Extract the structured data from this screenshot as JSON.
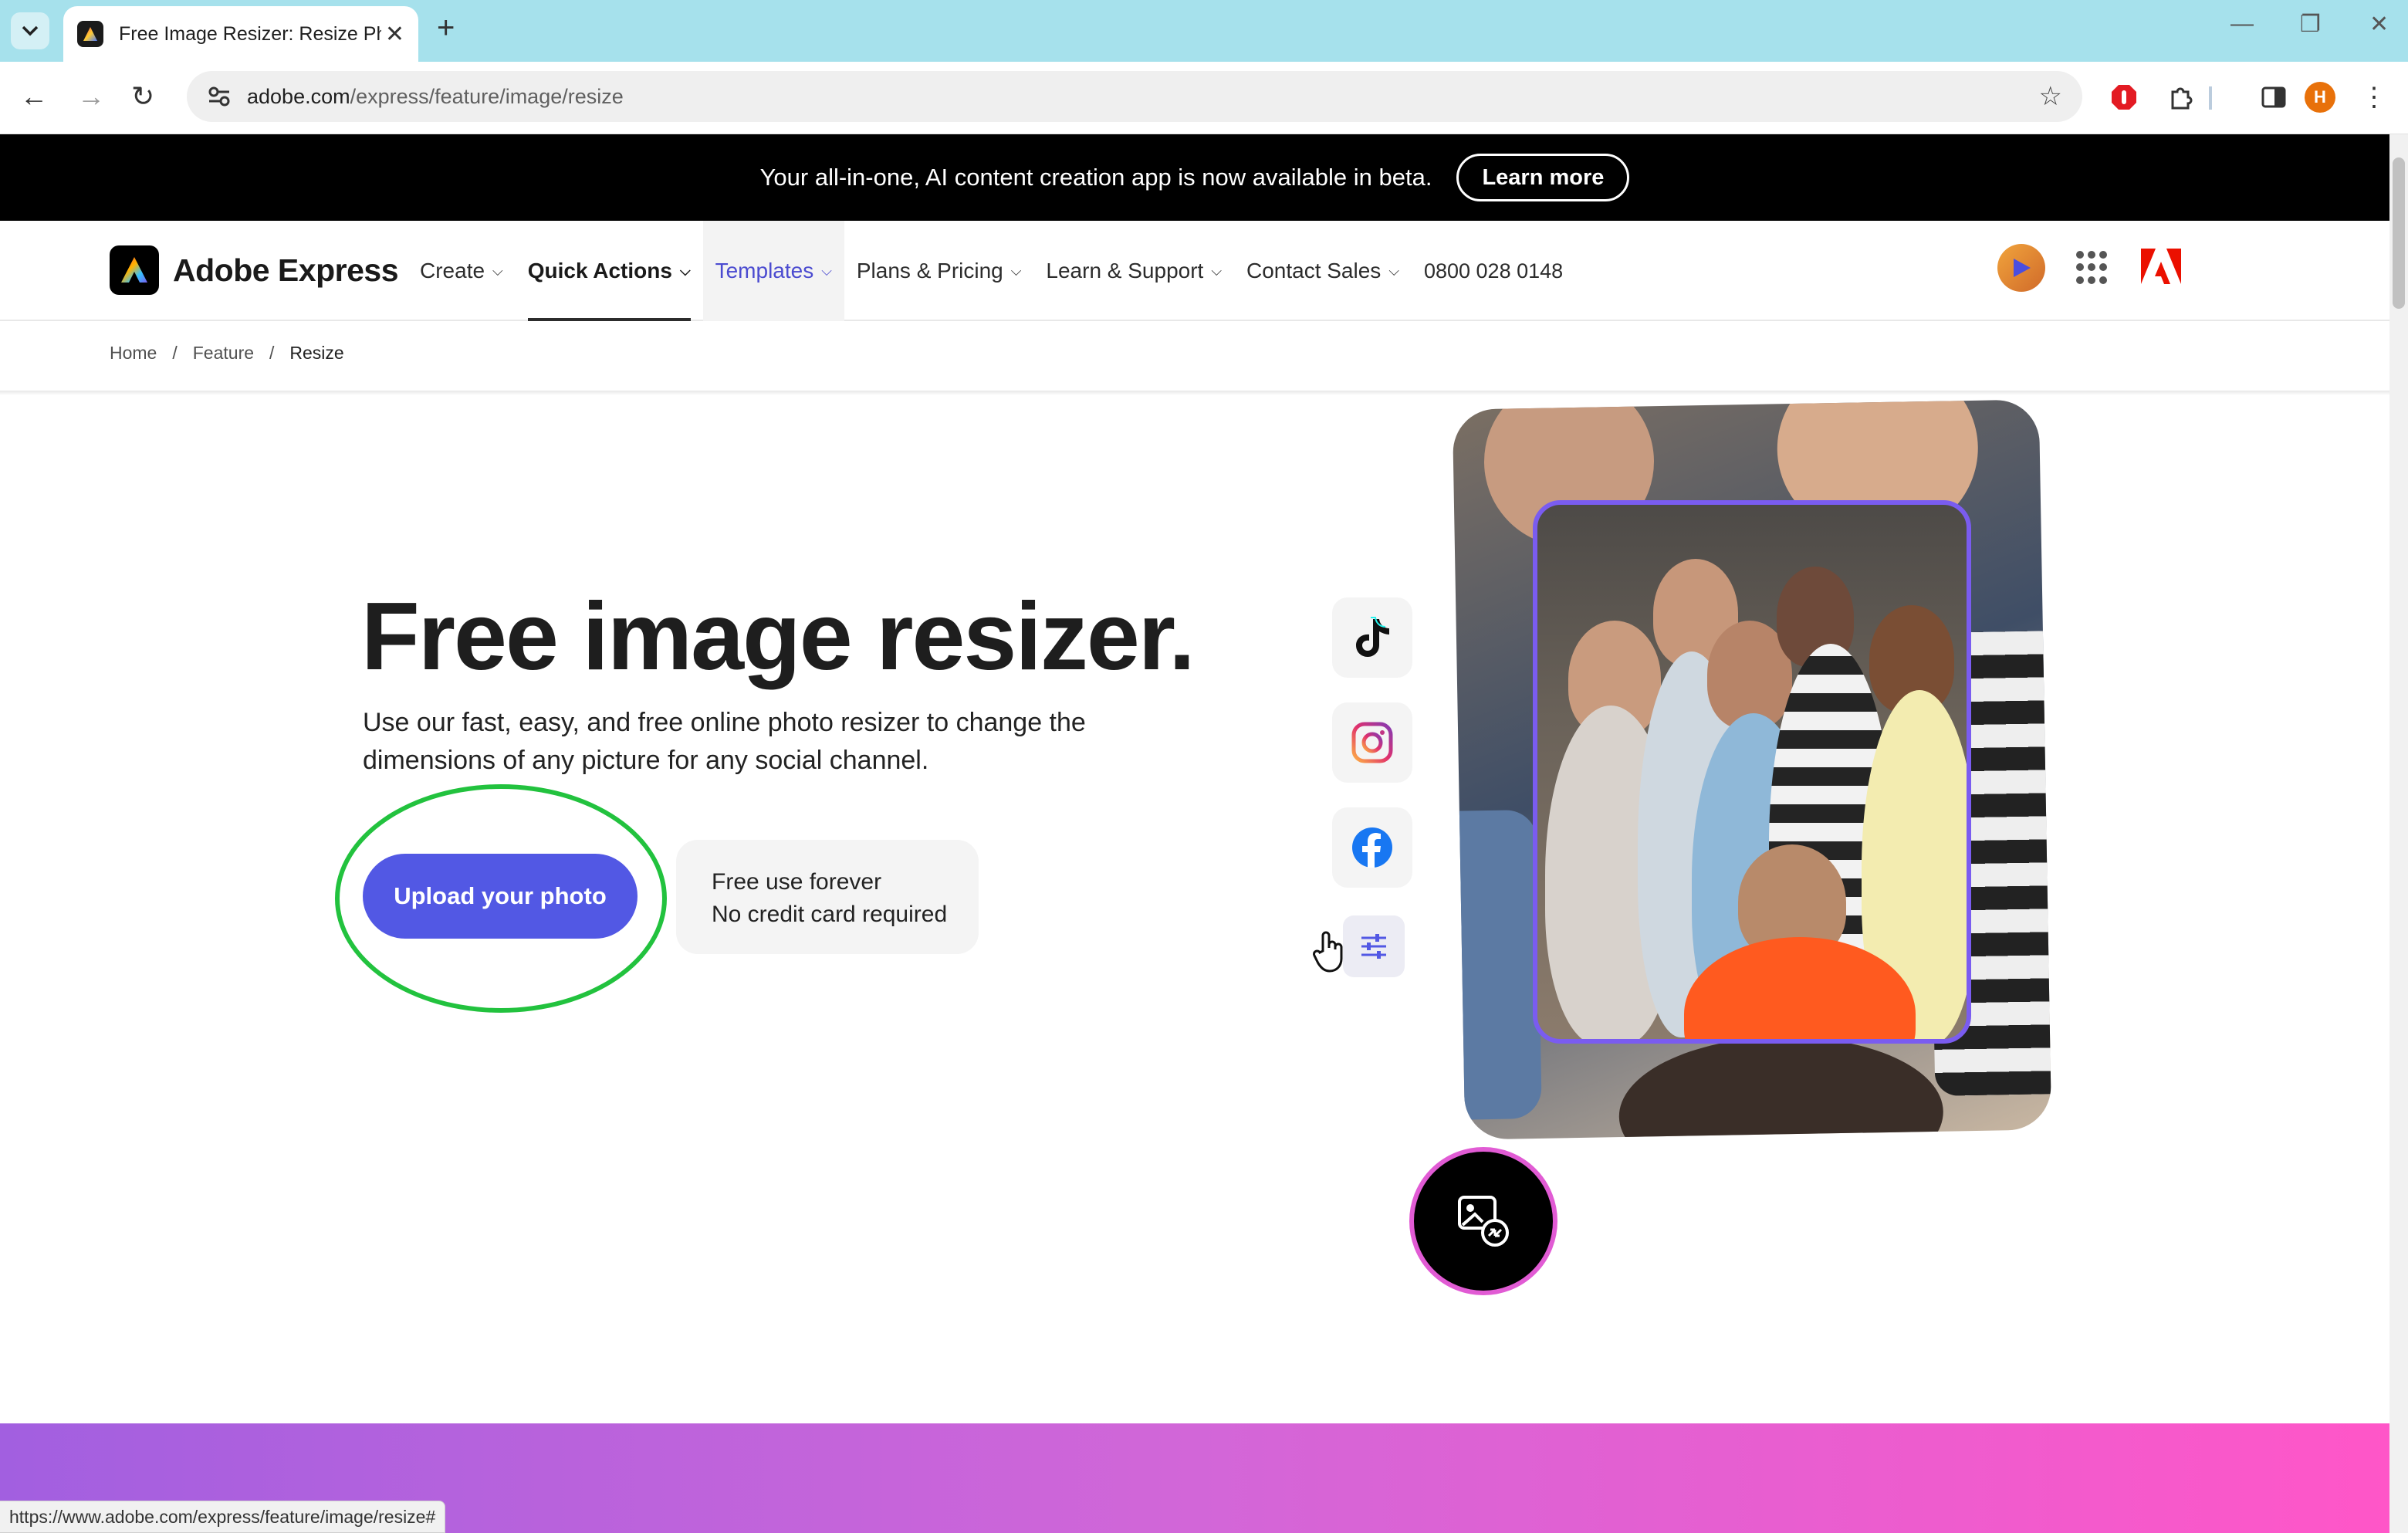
{
  "browser": {
    "tab_title": "Free Image Resizer: Resize Phot",
    "url_host": "adobe.com",
    "url_path": "/express/feature/image/resize",
    "status_url": "https://www.adobe.com/express/feature/image/resize#",
    "profile_initial": "H"
  },
  "promo": {
    "text": "Your all-in-one, AI content creation app is now available in beta.",
    "button": "Learn more"
  },
  "nav": {
    "brand": "Adobe Express",
    "items": [
      {
        "label": "Create"
      },
      {
        "label": "Quick Actions"
      },
      {
        "label": "Templates"
      },
      {
        "label": "Plans & Pricing"
      },
      {
        "label": "Learn & Support"
      },
      {
        "label": "Contact Sales"
      }
    ],
    "phone": "0800 028 0148"
  },
  "breadcrumb": {
    "home": "Home",
    "feature": "Feature",
    "current": "Resize",
    "separator": "/"
  },
  "hero": {
    "title": "Free image resizer.",
    "description": "Use our fast, easy, and free online photo resizer to change the dimensions of any picture for any social channel.",
    "cta": "Upload your photo",
    "free_line1": "Free use forever",
    "free_line2": "No credit card required"
  },
  "social_icons": [
    "tiktok-icon",
    "instagram-icon",
    "facebook-icon",
    "settings-sliders-icon"
  ],
  "colors": {
    "cta": "#5258e4",
    "promo_bg": "#000000",
    "highlight": "#22c23e",
    "frame": "#7a5cf0",
    "band_start": "#a25fe0",
    "band_end": "#ff56c8"
  }
}
